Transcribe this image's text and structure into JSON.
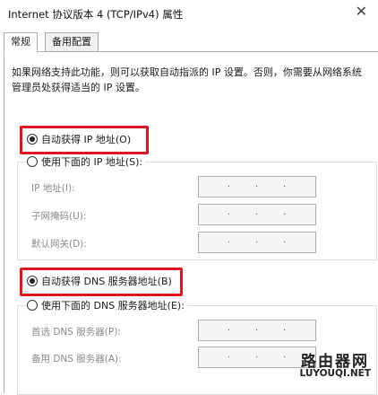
{
  "window": {
    "title": "Internet 协议版本 4 (TCP/IPv4) 属性",
    "close_glyph": "✕"
  },
  "tabs": [
    {
      "label": "常规",
      "active": true
    },
    {
      "label": "备用配置",
      "active": false
    }
  ],
  "description": "如果网络支持此功能，则可以获取自动指派的 IP 设置。否则，你需要从网络系统管理员处获得适当的 IP 设置。",
  "ip_section": {
    "auto_label": "自动获得 IP 地址(O)",
    "manual_label": "使用下面的 IP 地址(S):",
    "fields": [
      {
        "label": "IP 地址(I):",
        "value": ". . ."
      },
      {
        "label": "子网掩码(U):",
        "value": ". . ."
      },
      {
        "label": "默认网关(D):",
        "value": ". . ."
      }
    ]
  },
  "dns_section": {
    "auto_label": "自动获得 DNS 服务器地址(B)",
    "manual_label": "使用下面的 DNS 服务器地址(E):",
    "fields": [
      {
        "label": "首选 DNS 服务器(P):",
        "value": ". . ."
      },
      {
        "label": "备用 DNS 服务器(A):",
        "value": ". . ."
      }
    ]
  },
  "watermark": {
    "line1": "路由器网",
    "line2": "LUYOUQI.NET"
  },
  "colors": {
    "highlight": "#e0141e"
  }
}
